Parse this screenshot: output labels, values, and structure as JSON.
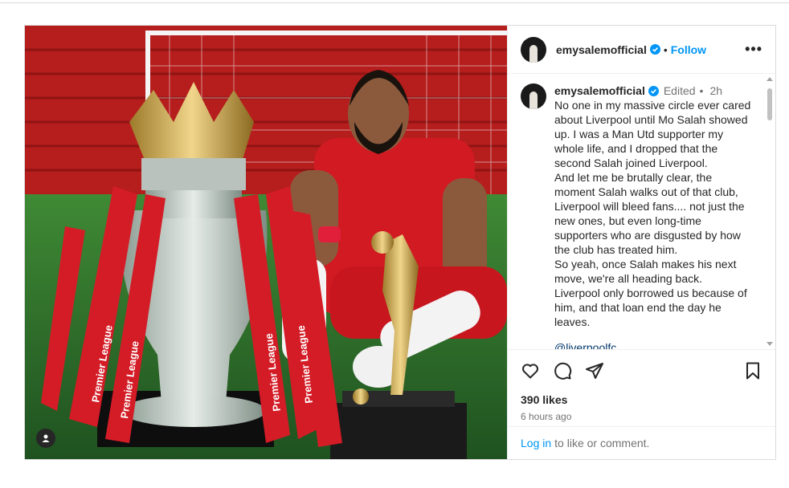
{
  "post": {
    "username": "emysalemofficial",
    "follow_label": "Follow",
    "dot_separator": "•",
    "more_label": "•••"
  },
  "caption": {
    "username": "emysalemofficial",
    "edited_label": "Edited",
    "separator": "•",
    "time": "2h",
    "text": "No one in my massive circle ever cared about Liverpool until Mo Salah showed up. I was a Man Utd supporter my whole life, and I dropped that the second Salah joined Liverpool.\nAnd let me be brutally clear, the moment Salah walks out of that club, Liverpool will bleed fans.... not just the new ones, but even long-time supporters who are disgusted by how the club has treated him.\nSo yeah, once Salah makes his next move, we're all heading back.\nLiverpool only borrowed us because of him, and that loan end the day he leaves.",
    "mention": "@liverpoolfc"
  },
  "stats": {
    "likes": "390 likes",
    "time_ago": "6 hours ago"
  },
  "login": {
    "link_label": "Log in",
    "rest_text": "to like or comment."
  },
  "icons": {
    "like": "heart-icon",
    "comment": "comment-icon",
    "share": "share-icon",
    "save": "bookmark-icon",
    "verified": "verified-badge-icon",
    "tagged": "user-tag-icon"
  },
  "colors": {
    "link_blue": "#0095f6",
    "text": "#262626",
    "muted": "#737373"
  }
}
